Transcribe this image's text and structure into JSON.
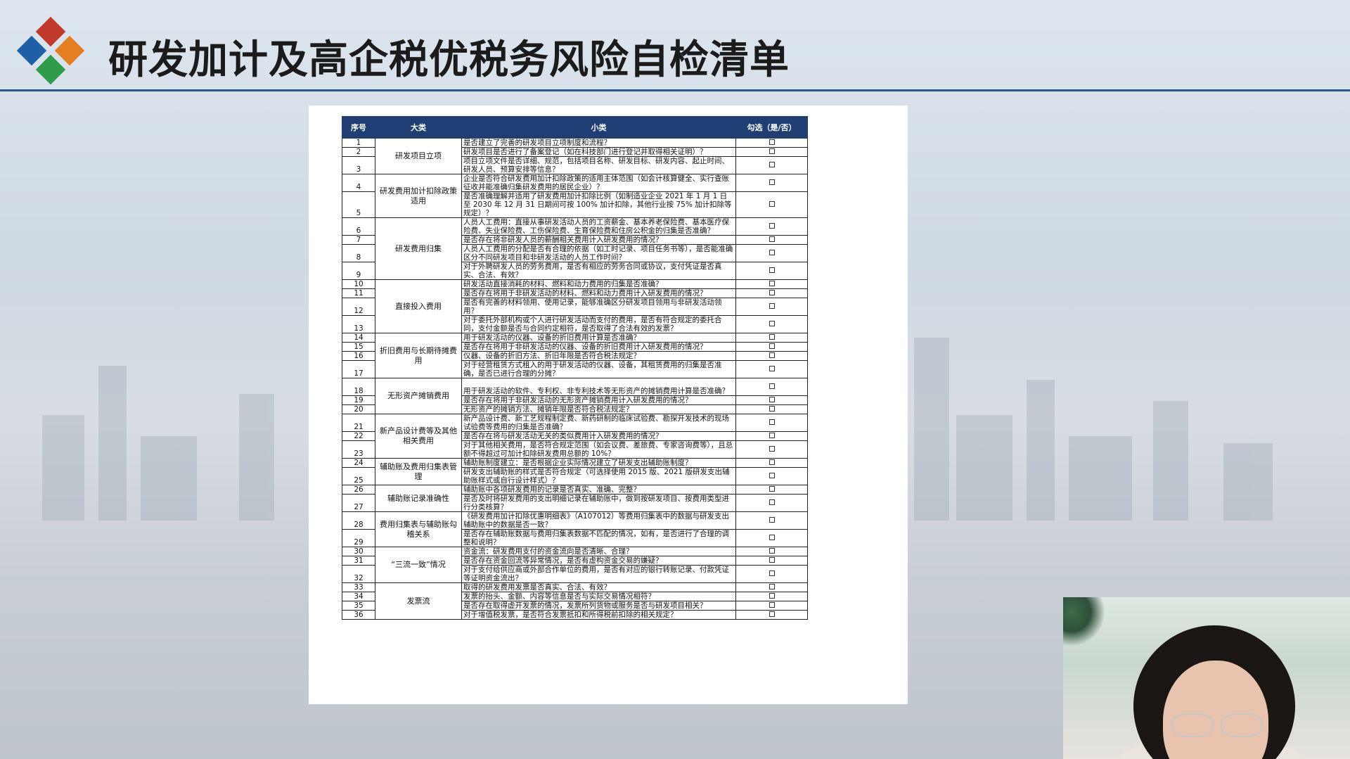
{
  "title": "研发加计及高企税优税务风险自检清单",
  "colors": {
    "accent": "#1f3f74",
    "rule": "#2e5a8c",
    "logo": [
      "#c0392b",
      "#1f5fa8",
      "#e67e22",
      "#2e9d4a"
    ]
  },
  "table": {
    "headers": [
      "序号",
      "大类",
      "小类",
      "勾选（是/否）"
    ],
    "check_glyph": "□",
    "rows": [
      {
        "n": "1",
        "cat": "研发项目立项",
        "span": 3,
        "sub": "是否建立了完善的研发项目立项制度和流程？"
      },
      {
        "n": "2",
        "sub": "研发项目是否进行了备案登记（如在科技部门进行登记并取得相关证明）？"
      },
      {
        "n": "3",
        "sub": "项目立项文件是否详细、规范，包括项目名称、研发目标、研发内容、起止时间、研发人员、预算安排等信息？",
        "h": 2
      },
      {
        "n": "4",
        "cat": "研发费用加计扣除政策适用",
        "span": 2,
        "sub": "企业是否符合研发费用加计扣除政策的适用主体范围（如会计核算健全、实行查账征收并能准确归集研发费用的居民企业）？",
        "h": 2
      },
      {
        "n": "5",
        "sub": "是否准确理解并适用了研发费用加计扣除比例（如制造业企业 2021 年 1 月 1 日至 2030 年 12 月 31 日期间可按 100% 加计扣除，其他行业按 75% 加计扣除等规定）？",
        "h": 3
      },
      {
        "n": "6",
        "cat": "研发费用归集",
        "span": 4,
        "sub": "人员人工费用：直接从事研发活动人员的工资薪金、基本养老保险费、基本医疗保险费、失业保险费、工伤保险费、生育保险费和住房公积金的归集是否准确？",
        "h": 2
      },
      {
        "n": "7",
        "sub": "是否存在将非研发人员的薪酬相关费用计入研发费用的情况？"
      },
      {
        "n": "8",
        "sub": "人员人工费用的分配是否有合理的依据（如工时记录、项目任务书等），是否能准确区分不同研发项目和非研发活动的人员工作时间？",
        "h": 2
      },
      {
        "n": "9",
        "sub": "对于外聘研发人员的劳务费用，是否有相应的劳务合同或协议，支付凭证是否真实、合法、有效？",
        "h": 2
      },
      {
        "n": "10",
        "cat": "直接投入费用",
        "span": 4,
        "sub": "研发活动直接消耗的材料、燃料和动力费用的归集是否准确？"
      },
      {
        "n": "11",
        "sub": "是否存在将用于非研发活动的材料、燃料和动力费用计入研发费用的情况？"
      },
      {
        "n": "12",
        "sub": "是否有完善的材料领用、使用记录，能够准确区分研发项目领用与非研发活动领用？",
        "h": 2
      },
      {
        "n": "13",
        "sub": "对于委托外部机构或个人进行研发活动而支付的费用，是否有符合规定的委托合同，支付金额是否与合同约定相符，是否取得了合法有效的发票？",
        "h": 2
      },
      {
        "n": "14",
        "cat": "折旧费用与长期待摊费用",
        "span": 4,
        "sub": "用于研发活动的仪器、设备的折旧费用计算是否准确？"
      },
      {
        "n": "15",
        "sub": "是否存在将用于非研发活动的仪器、设备的折旧费用计入研发费用的情况？"
      },
      {
        "n": "16",
        "sub": "仪器、设备的折旧方法、折旧年限是否符合税法规定？"
      },
      {
        "n": "17",
        "sub": "对于经营租赁方式租入的用于研发活动的仪器、设备，其租赁费用的归集是否准确，是否已进行合理的分摊？",
        "h": 2
      },
      {
        "n": "18",
        "cat": "无形资产摊销费用",
        "span": 3,
        "sub": "用于研发活动的软件、专利权、非专利技术等无形资产的摊销费用计算是否准确？",
        "h": 2
      },
      {
        "n": "19",
        "sub": "是否存在将用于非研发活动的无形资产摊销费用计入研发费用的情况？"
      },
      {
        "n": "20",
        "sub": "无形资产的摊销方法、摊销年限是否符合税法规定？"
      },
      {
        "n": "21",
        "cat": "新产品设计费等及其他相关费用",
        "span": 3,
        "sub": "新产品设计费、新工艺规程制定费、新药研制的临床试验费、勘探开发技术的现场试验费等费用的归集是否准确？",
        "h": 2
      },
      {
        "n": "22",
        "sub": "是否存在将与研发活动无关的类似费用计入研发费用的情况？"
      },
      {
        "n": "23",
        "sub": "对于其他相关费用，是否符合规定范围（如会议费、差旅费、专家咨询费等），且总额不得超过可加计扣除研发费用总额的 10%？",
        "h": 2
      },
      {
        "n": "24",
        "cat": "辅助账及费用归集表管理",
        "span": 2,
        "sub": "辅助账制度建立：是否根据企业实际情况建立了研发支出辅助账制度？"
      },
      {
        "n": "25",
        "sub": "研发支出辅助账的样式是否符合规定（可选择使用 2015 版、2021 版研发支出辅助账样式或自行设计样式）？",
        "h": 2
      },
      {
        "n": "26",
        "cat": "辅助账记录准确性",
        "span": 2,
        "sub": "辅助账中各项研发费用的记录是否真实、准确、完整？"
      },
      {
        "n": "27",
        "sub": "是否及时将研发费用的支出明细记录在辅助账中，做到按研发项目、按费用类型进行分类核算？",
        "h": 2
      },
      {
        "n": "28",
        "cat": "费用归集表与辅助账勾稽关系",
        "span": 2,
        "sub": "《研发费用加计扣除优惠明细表》（A107012）等费用归集表中的数据与研发支出辅助账中的数据是否一致？",
        "h": 2
      },
      {
        "n": "29",
        "sub": "是否存在辅助账数据与费用归集表数据不匹配的情况，如有，是否进行了合理的调整和说明？",
        "h": 2
      },
      {
        "n": "30",
        "cat": "“三流一致”情况",
        "span": 3,
        "sub": "资金流：研发费用支付的资金流向是否清晰、合理？"
      },
      {
        "n": "31",
        "sub": "是否存在资金回流等异常情况，是否有虚构资金交易的嫌疑？"
      },
      {
        "n": "32",
        "sub": "对于支付给供应商或外部合作单位的费用，是否有对应的银行转账记录、付款凭证等证明资金流出？",
        "h": 2
      },
      {
        "n": "33",
        "cat": "发票流",
        "span": 4,
        "sub": "取得的研发费用发票是否真实、合法、有效？"
      },
      {
        "n": "34",
        "sub": "发票的抬头、金额、内容等信息是否与实际交易情况相符？"
      },
      {
        "n": "35",
        "sub": "是否存在取得虚开发票的情况，发票所列货物或服务是否与研发项目相关？"
      },
      {
        "n": "36",
        "sub": "对于增值税发票，是否符合发票抵扣和所得税前扣除的相关规定？"
      }
    ]
  },
  "video": {
    "label": "presenter-webcam"
  }
}
